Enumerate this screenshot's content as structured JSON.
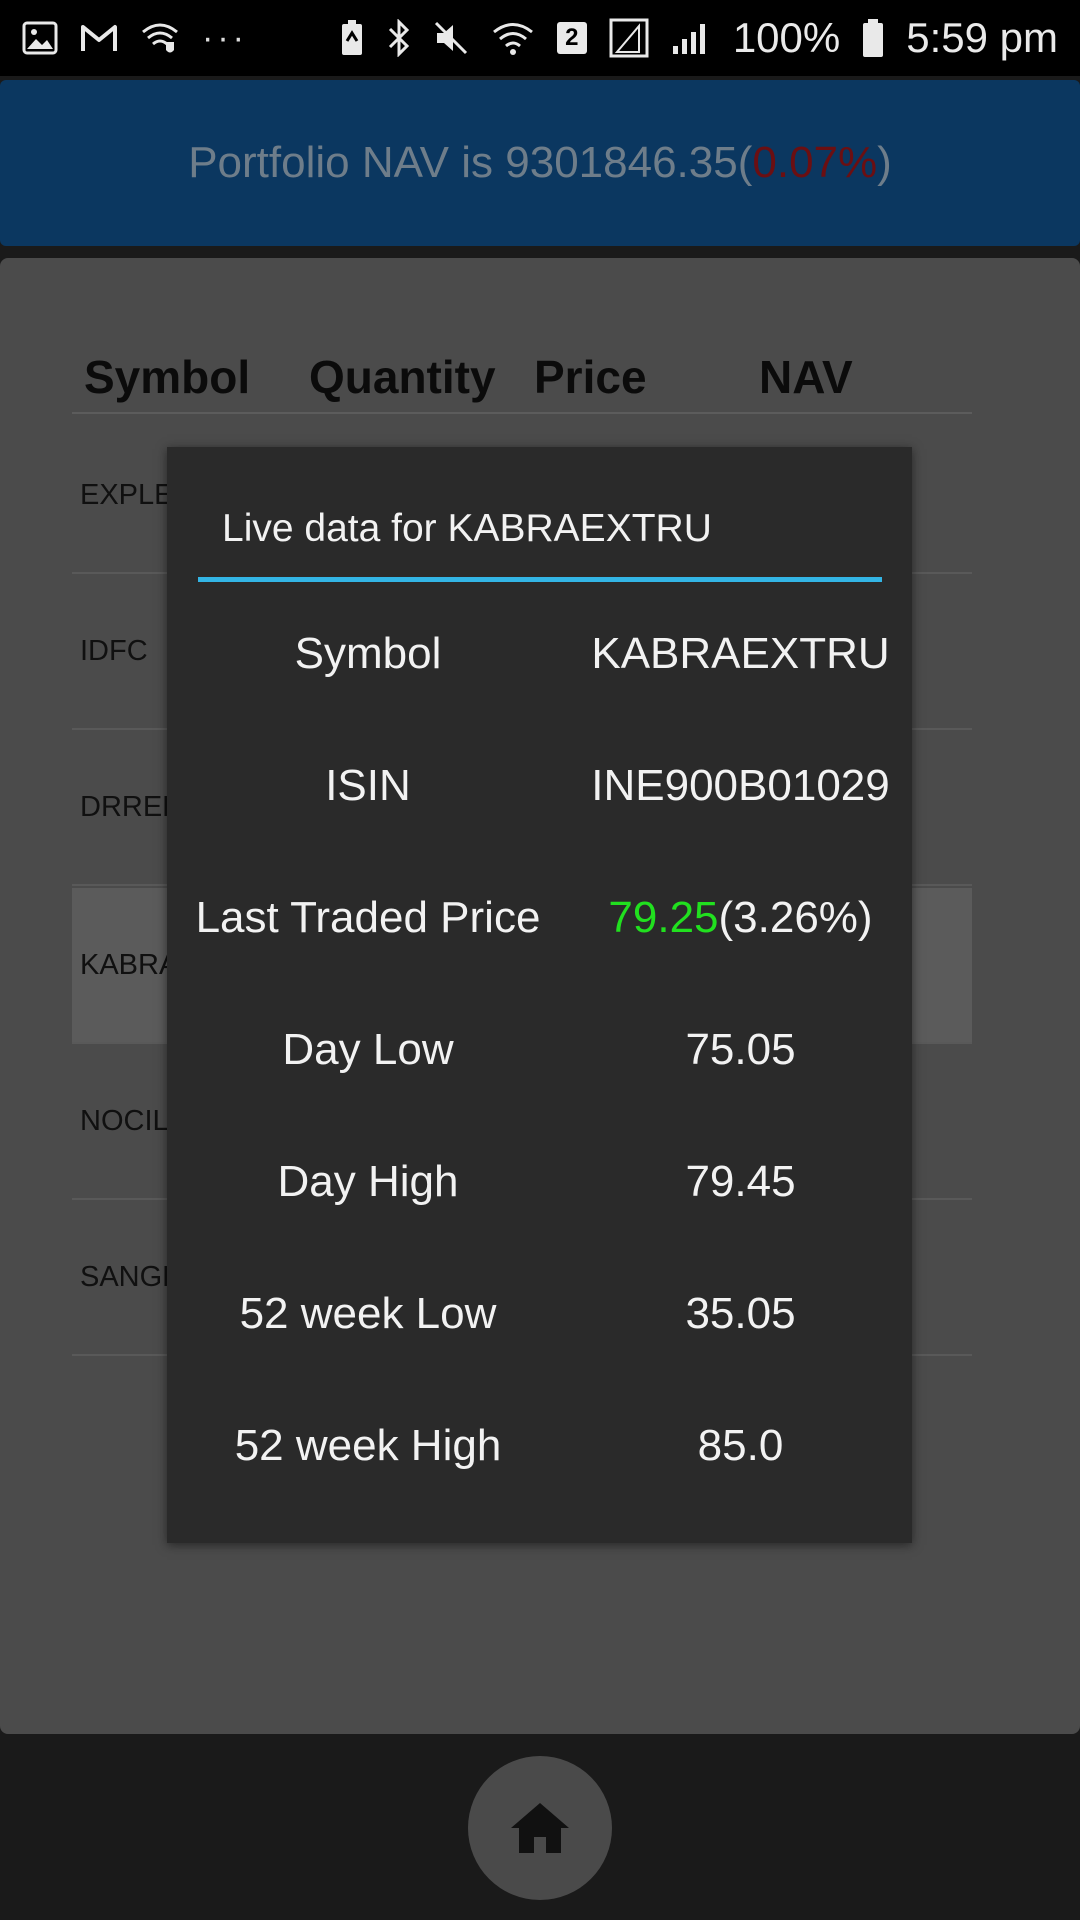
{
  "status_bar": {
    "left_icons": [
      "gallery-icon",
      "gmail-icon",
      "wifi-secure-icon"
    ],
    "overflow": "···",
    "right_icons": [
      "battery-saver-icon",
      "bluetooth-icon",
      "mute-icon",
      "wifi-icon",
      "lte-icon",
      "signal-icon"
    ],
    "sim_badge": "2",
    "battery": "100%",
    "time": "5:59 pm"
  },
  "header": {
    "title_prefix": "Portfolio NAV is 9301846.35(",
    "change": "0.07%",
    "title_suffix": ")",
    "change_color": "#6b0f12"
  },
  "table": {
    "columns": [
      "Symbol",
      "Quantity",
      "Price",
      "NAV"
    ],
    "rows": [
      {
        "symbol": "EXPLE"
      },
      {
        "symbol": "IDFC"
      },
      {
        "symbol": "DRRED"
      },
      {
        "symbol": "KABRA"
      },
      {
        "symbol": "NOCIL"
      },
      {
        "symbol": "SANGH"
      }
    ]
  },
  "pager": {
    "prev_icon": "chevron-left-icon",
    "next_icon": "chevron-right-icon"
  },
  "home": {
    "icon": "home-icon"
  },
  "dialog": {
    "title": "Live data for KABRAEXTRU",
    "accent": "#33b5e5",
    "fields": [
      {
        "label": "Symbol",
        "value": "KABRAEXTRU"
      },
      {
        "label": "ISIN",
        "value": "INE900B01029"
      },
      {
        "label": "Last Traded Price",
        "value_main": "79.25",
        "value_change": "(3.26%)",
        "value_color": "#21e01f"
      },
      {
        "label": "Day Low",
        "value": "75.05"
      },
      {
        "label": "Day High",
        "value": "79.45"
      },
      {
        "label": "52 week Low",
        "value": "35.05"
      },
      {
        "label": "52 week High",
        "value": "85.0"
      }
    ]
  }
}
